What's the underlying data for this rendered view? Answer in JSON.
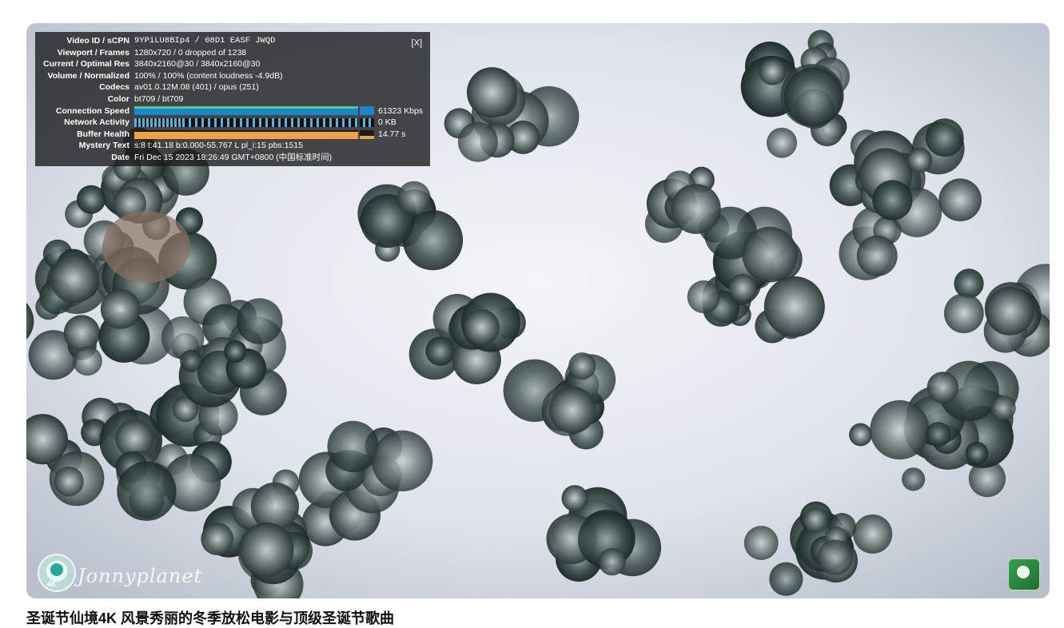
{
  "stats": {
    "close_label": "[X]",
    "rows": {
      "video_id": {
        "label": "Video ID / sCPN",
        "value": "9YPiLU8BIp4 / 08D1 EASF JWQD"
      },
      "viewport": {
        "label": "Viewport / Frames",
        "value": "1280x720 / 0 dropped of 1238"
      },
      "resolution": {
        "label": "Current / Optimal Res",
        "value": "3840x2160@30 / 3840x2160@30"
      },
      "volume": {
        "label": "Volume / Normalized",
        "value": "100% / 100% (content loudness -4.9dB)"
      },
      "codecs": {
        "label": "Codecs",
        "value": "av01.0.12M.08 (401) / opus (251)"
      },
      "color": {
        "label": "Color",
        "value": "bt709 / bt709"
      },
      "connection": {
        "label": "Connection Speed",
        "value": "61323 Kbps"
      },
      "network": {
        "label": "Network Activity",
        "value": "0 KB"
      },
      "buffer": {
        "label": "Buffer Health",
        "value": "14.77 s"
      },
      "mystery": {
        "label": "Mystery Text",
        "value": "s:8 t:41.18 b:0.000-55.767 L pl_i:15 pbs:1515"
      },
      "date": {
        "label": "Date",
        "value": "Fri Dec 15 2023 18:26:49 GMT+0800 (中国标准时间)"
      }
    }
  },
  "watermark": {
    "badge_text": "4K",
    "signature": "Jonnyplanet"
  },
  "video_title": "圣诞节仙境4K 风景秀丽的冬季放松电影与顶级圣诞节歌曲",
  "colors": {
    "connection_bar": "#1d86c8",
    "connection_top": "#5cc6a0",
    "network_bar": "#5ab0d8",
    "buffer_bar": "#f2a04a"
  }
}
